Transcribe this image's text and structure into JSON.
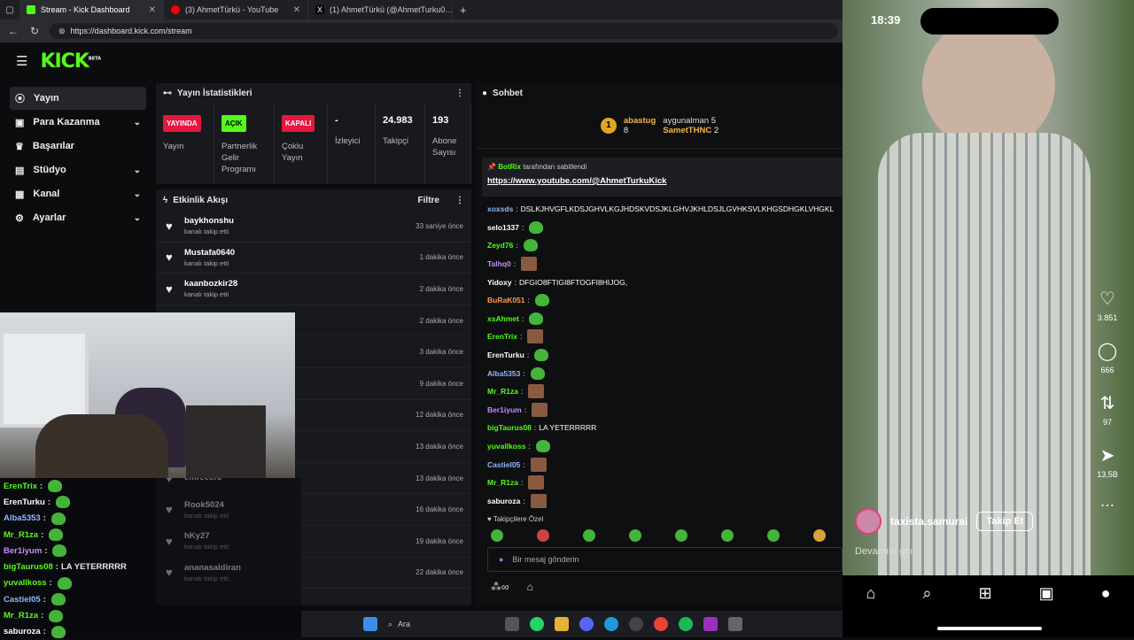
{
  "browser": {
    "tabs": [
      {
        "label": "Stream - Kick Dashboard",
        "color": "#53fc18"
      },
      {
        "label": "(3) AhmetTürkü - YouTube",
        "color": "#ff0000"
      },
      {
        "label": "(1) AhmetTürkü (@AhmetTurku0…",
        "color": "#000000"
      }
    ],
    "url": "https://dashboard.kick.com/stream"
  },
  "kick": {
    "logo": "KICK",
    "beta": "BETA"
  },
  "sidebar": {
    "items": [
      {
        "label": "Yayın"
      },
      {
        "label": "Para Kazanma"
      },
      {
        "label": "Başarılar"
      },
      {
        "label": "Stüdyo"
      },
      {
        "label": "Kanal"
      },
      {
        "label": "Ayarlar"
      }
    ]
  },
  "stats": {
    "title": "Yayın İstatistikleri",
    "cols": [
      {
        "badge": "YAYINDA",
        "badge_bg": "#e5173f",
        "label": "Yayın"
      },
      {
        "badge": "AÇIK",
        "badge_bg": "#53fc18",
        "label": "Partnerlik Gelir Programı"
      },
      {
        "badge": "KAPALI",
        "badge_bg": "#e5173f",
        "label": "Çoklu Yayın"
      },
      {
        "value": "-",
        "label": "İzleyici"
      },
      {
        "value": "24.983",
        "label": "Takipçi"
      },
      {
        "value": "193",
        "label": "Abone Sayısı"
      }
    ]
  },
  "activity": {
    "title": "Etkinlik Akışı",
    "filter": "Filtre",
    "rows": [
      {
        "user": "baykhonshu",
        "action": "kanalı takip etti",
        "time": "33 saniye önce"
      },
      {
        "user": "Mustafa0640",
        "action": "kanalı takip etti",
        "time": "1 dakika önce"
      },
      {
        "user": "kaanbozkir28",
        "action": "kanalı takip etti",
        "time": "2 dakika önce"
      },
      {
        "user": "",
        "action": "",
        "time": "2 dakika önce"
      },
      {
        "user": "",
        "action": "",
        "time": "3 dakika önce"
      },
      {
        "user": "",
        "action": "",
        "time": "9 dakika önce"
      },
      {
        "user": "",
        "action": "",
        "time": "12 dakika önce"
      },
      {
        "user": "",
        "action": "",
        "time": "13 dakika önce"
      },
      {
        "user": "emreeer8",
        "action": "",
        "time": "13 dakika önce"
      },
      {
        "user": "Rook5024",
        "action": "kanalı takip etti",
        "time": "16 dakika önce"
      },
      {
        "user": "hKy27",
        "action": "kanalı takip etti",
        "time": "19 dakika önce"
      },
      {
        "user": "ananasaldiran",
        "action": "kanalı takip etti",
        "time": "22 dakika önce"
      }
    ]
  },
  "chat": {
    "title": "Sohbet",
    "gifters": [
      {
        "name": "abastug",
        "count": "8",
        "rank": "1"
      },
      {
        "name": "aygunalman",
        "count": "5"
      },
      {
        "name": "SametTHNC",
        "count": "2"
      }
    ],
    "pinned": {
      "by": "BotRix",
      "text": "tarafından sabitlendi",
      "link": "https://www.youtube.com/@AhmetTurkuKick"
    },
    "messages": [
      {
        "user": "xoxsds",
        "color": "#8fb7ff",
        "text": "DSLKJHVGFLKDSJGHVLKGJHDSKVDSJKLGHVJKHLDSJLGVHKSVLKHGSDHGKLVHGKL"
      },
      {
        "user": "selo1337",
        "color": "#ffffff",
        "emote": "pepe"
      },
      {
        "user": "Zeyd76",
        "color": "#53fc18",
        "emote": "pepe"
      },
      {
        "user": "Talhq0",
        "color": "#c88bff",
        "emote": "face"
      },
      {
        "user": "Yidoxy",
        "color": "#ffffff",
        "text": "DFGIO8FTIGI8FTOGFI8HIJOG,"
      },
      {
        "user": "BuRaK051",
        "color": "#ff9a4d",
        "emote": "pepe"
      },
      {
        "user": "xsAhmet",
        "color": "#53fc18",
        "emote": "pepe"
      },
      {
        "user": "ErenTrix",
        "color": "#53fc18",
        "emote": "face"
      },
      {
        "user": "ErenTurku",
        "color": "#ffffff",
        "emote": "pepe"
      },
      {
        "user": "Alba5353",
        "color": "#8fb7ff",
        "emote": "pepe"
      },
      {
        "user": "Mr_R1za",
        "color": "#53fc18",
        "emote": "face"
      },
      {
        "user": "Ber1iyum",
        "color": "#c88bff",
        "emote": "face"
      },
      {
        "user": "bigTaurus08",
        "color": "#53fc18",
        "text": "LA YETERRRRR"
      },
      {
        "user": "yuvallkoss",
        "color": "#53fc18",
        "emote": "pepe"
      },
      {
        "user": "Castiel05",
        "color": "#8fb7ff",
        "emote": "face"
      },
      {
        "user": "Mr_R1za",
        "color": "#53fc18",
        "emote": "face"
      },
      {
        "user": "saburoza",
        "color": "#ffffff",
        "emote": "face"
      }
    ],
    "followers_only": "Takipçilere Özel",
    "input_placeholder": "Bir mesaj gönderin"
  },
  "overlay_chat": [
    {
      "user": "ErenTrix",
      "color": "#53fc18"
    },
    {
      "user": "ErenTurku",
      "color": "#ffffff"
    },
    {
      "user": "Alba5353",
      "color": "#8fb7ff"
    },
    {
      "user": "Mr_R1za",
      "color": "#53fc18"
    },
    {
      "user": "Ber1iyum",
      "color": "#c88bff"
    },
    {
      "user": "bigTaurus08",
      "color": "#53fc18",
      "text": "LA YETERRRRR"
    },
    {
      "user": "yuvallkoss",
      "color": "#53fc18"
    },
    {
      "user": "Castiel05",
      "color": "#8fb7ff"
    },
    {
      "user": "Mr_R1za",
      "color": "#53fc18"
    },
    {
      "user": "saburoza",
      "color": "#ffffff"
    }
  ],
  "taskbar": {
    "search": "Ara"
  },
  "phone": {
    "time": "18:39",
    "likes": "3.851",
    "comments": "666",
    "shares": "97",
    "sends": "13,5B",
    "creator": "taxista.samurai",
    "follow": "Takip Et",
    "more": "Devamını gör"
  }
}
